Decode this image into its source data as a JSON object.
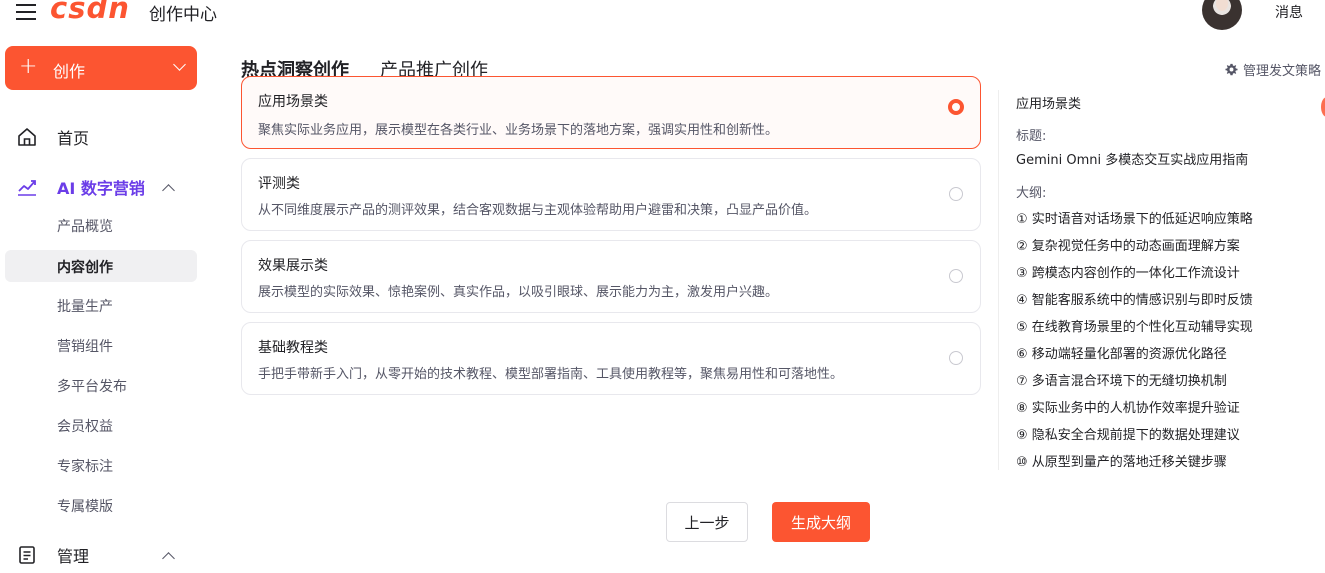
{
  "header": {
    "logo": "csdn",
    "app_title": "创作中心",
    "messages_label": "消息"
  },
  "sidebar": {
    "create_label": "创作",
    "home_label": "首页",
    "ai_marketing_label": "AI 数字营销",
    "sub_items": [
      "产品概览",
      "内容创作",
      "批量生产",
      "营销组件",
      "多平台发布",
      "会员权益",
      "专家标注",
      "专属模版"
    ],
    "active_sub_item": "内容创作",
    "manage_label": "管理"
  },
  "tabs": [
    {
      "label": "热点洞察创作",
      "active": true
    },
    {
      "label": "产品推广创作",
      "active": false
    }
  ],
  "manage_strategy_label": "管理发文策略",
  "options": [
    {
      "title": "应用场景类",
      "desc": "聚焦实际业务应用，展示模型在各类行业、业务场景下的落地方案，强调实用性和创新性。",
      "selected": true
    },
    {
      "title": "评测类",
      "desc": "从不同维度展示产品的测评效果，结合客观数据与主观体验帮助用户避雷和决策，凸显产品价值。",
      "selected": false
    },
    {
      "title": "效果展示类",
      "desc": "展示模型的实际效果、惊艳案例、真实作品，以吸引眼球、展示能力为主，激发用户兴趣。",
      "selected": false
    },
    {
      "title": "基础教程类",
      "desc": "手把手带新手入门，从零开始的技术教程、模型部署指南、工具使用教程等，聚焦易用性和可落地性。",
      "selected": false
    }
  ],
  "preview": {
    "category": "应用场景类",
    "title_label": "标题:",
    "title": "Gemini Omni 多模态交互实战应用指南",
    "outline_label": "大纲:",
    "outline": [
      "① 实时语音对话场景下的低延迟响应策略",
      "② 复杂视觉任务中的动态画面理解方案",
      "③ 跨模态内容创作的一体化工作流设计",
      "④ 智能客服系统中的情感识别与即时反馈",
      "⑤ 在线教育场景里的个性化互动辅导实现",
      "⑥ 移动端轻量化部署的资源优化路径",
      "⑦ 多语言混合环境下的无缝切换机制",
      "⑧ 实际业务中的人机协作效率提升验证",
      "⑨ 隐私安全合规前提下的数据处理建议",
      "⑩ 从原型到量产的落地迁移关键步骤"
    ]
  },
  "buttons": {
    "prev": "上一步",
    "generate": "生成大纲"
  },
  "colors": {
    "brand": "#fc5531",
    "ai_purple": "#6b3de8"
  }
}
